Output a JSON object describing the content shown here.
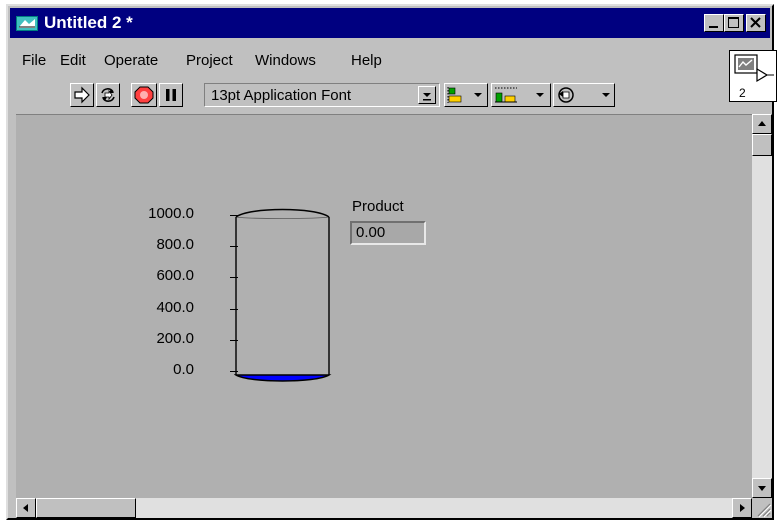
{
  "window": {
    "title": "Untitled 2 *"
  },
  "menu": [
    "File",
    "Edit",
    "Operate",
    "Project",
    "Windows",
    "Help"
  ],
  "toolbar": {
    "font_value": "13pt Application Font",
    "run_icon_number": "2"
  },
  "tank": {
    "scale_labels": [
      "1000.0",
      "800.0",
      "600.0",
      "400.0",
      "200.0",
      "0.0"
    ],
    "scale_min": 0,
    "scale_max": 1000,
    "level": 0,
    "fill_color": "#0000ff"
  },
  "indicator": {
    "label": "Product",
    "value": "0.00"
  },
  "colors": {
    "titlebar": "#000080",
    "panel": "#b0b0b0",
    "window": "#c0c0c0"
  }
}
